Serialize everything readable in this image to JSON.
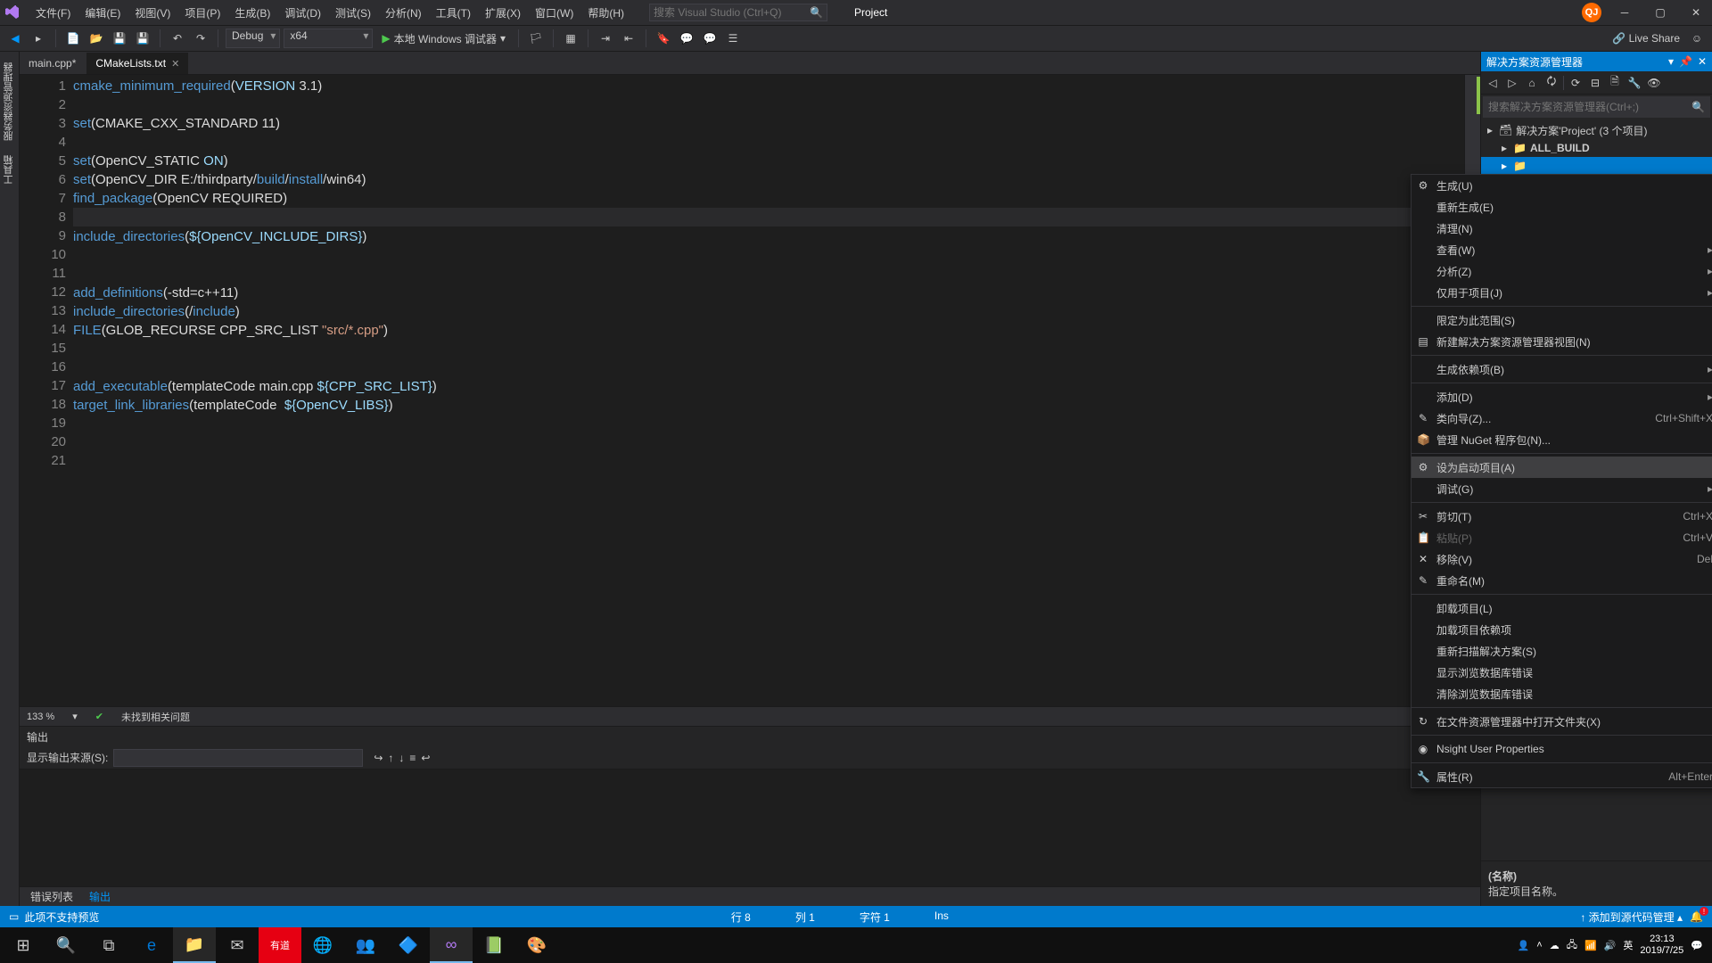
{
  "titlebar": {
    "menus": [
      "文件(F)",
      "编辑(E)",
      "视图(V)",
      "项目(P)",
      "生成(B)",
      "调试(D)",
      "测试(S)",
      "分析(N)",
      "工具(T)",
      "扩展(X)",
      "窗口(W)",
      "帮助(H)"
    ],
    "search_placeholder": "搜索 Visual Studio (Ctrl+Q)",
    "project_title": "Project",
    "user_badge": "QJ"
  },
  "toolbar": {
    "config": "Debug",
    "platform": "x64",
    "debug_label": "本地 Windows 调试器",
    "live_share": "Live Share"
  },
  "left_toolwell": [
    "服务器资源管理器",
    "工具箱"
  ],
  "tabs": {
    "items": [
      {
        "label": "main.cpp*",
        "active": false
      },
      {
        "label": "CMakeLists.txt",
        "active": true
      }
    ]
  },
  "code": {
    "lines": [
      {
        "n": 1,
        "html": "<span class='cmd'>cmake_minimum_required</span>(<span class='var'>VERSION</span> 3.1)"
      },
      {
        "n": 2,
        "html": ""
      },
      {
        "n": 3,
        "html": "<span class='cmd'>set</span>(CMAKE_CXX_STANDARD 11)"
      },
      {
        "n": 4,
        "html": ""
      },
      {
        "n": 5,
        "html": "<span class='cmd'>set</span>(OpenCV_STATIC <span class='var'>ON</span>)"
      },
      {
        "n": 6,
        "html": "<span class='cmd'>set</span>(OpenCV_DIR E:/thirdparty/<span class='path'>build</span>/<span class='path'>install</span>/win64)"
      },
      {
        "n": 7,
        "html": "<span class='cmd'>find_package</span>(OpenCV REQUIRED)"
      },
      {
        "n": 8,
        "html": ""
      },
      {
        "n": 9,
        "html": "<span class='cmd'>include_directories</span>(<span class='var'>${OpenCV_INCLUDE_DIRS}</span>)"
      },
      {
        "n": 10,
        "html": ""
      },
      {
        "n": 11,
        "html": ""
      },
      {
        "n": 12,
        "html": "<span class='cmd'>add_definitions</span>(-std=c++11)"
      },
      {
        "n": 13,
        "html": "<span class='cmd'>include_directories</span>(/<span class='path'>include</span>)"
      },
      {
        "n": 14,
        "html": "<span class='cmd'>FILE</span>(GLOB_RECURSE CPP_SRC_LIST <span class='str'>\"src/*.cpp\"</span>)"
      },
      {
        "n": 15,
        "html": ""
      },
      {
        "n": 16,
        "html": ""
      },
      {
        "n": 17,
        "html": "<span class='cmd'>add_executable</span>(templateCode main.cpp <span class='var'>${CPP_SRC_LIST}</span>)"
      },
      {
        "n": 18,
        "html": "<span class='cmd'>target_link_libraries</span>(templateCode  <span class='var'>${OpenCV_LIBS}</span>)"
      },
      {
        "n": 19,
        "html": ""
      },
      {
        "n": 20,
        "html": ""
      },
      {
        "n": 21,
        "html": ""
      }
    ],
    "cursor_line": 8
  },
  "status_strip": {
    "zoom": "133 %",
    "issues": "未找到相关问题"
  },
  "output": {
    "title": "输出",
    "source_label": "显示输出来源(S):"
  },
  "bottom_tabs": [
    "错误列表",
    "输出"
  ],
  "solution_panel": {
    "title": "解决方案资源管理器",
    "search_placeholder": "搜索解决方案资源管理器(Ctrl+;)",
    "solution_label": "解决方案'Project' (3 个项目)",
    "items": [
      {
        "name": "ALL_BUILD",
        "selected": false
      },
      {
        "name": "",
        "selected": true
      }
    ]
  },
  "context_menu": {
    "groups": [
      [
        {
          "label": "生成(U)",
          "icon": "⚙"
        },
        {
          "label": "重新生成(E)"
        },
        {
          "label": "清理(N)"
        },
        {
          "label": "查看(W)",
          "sub": true
        },
        {
          "label": "分析(Z)",
          "sub": true
        },
        {
          "label": "仅用于项目(J)",
          "sub": true
        }
      ],
      [
        {
          "label": "限定为此范围(S)"
        },
        {
          "label": "新建解决方案资源管理器视图(N)",
          "icon": "▤"
        }
      ],
      [
        {
          "label": "生成依赖项(B)",
          "sub": true
        }
      ],
      [
        {
          "label": "添加(D)",
          "sub": true
        },
        {
          "label": "类向导(Z)...",
          "icon": "✎",
          "shortcut": "Ctrl+Shift+X"
        },
        {
          "label": "管理 NuGet 程序包(N)...",
          "icon": "📦"
        }
      ],
      [
        {
          "label": "设为启动项目(A)",
          "icon": "⚙",
          "highlighted": true
        },
        {
          "label": "调试(G)",
          "sub": true
        }
      ],
      [
        {
          "label": "剪切(T)",
          "icon": "✂",
          "shortcut": "Ctrl+X"
        },
        {
          "label": "粘贴(P)",
          "icon": "📋",
          "shortcut": "Ctrl+V",
          "disabled": true
        },
        {
          "label": "移除(V)",
          "icon": "✕",
          "shortcut": "Del"
        },
        {
          "label": "重命名(M)",
          "icon": "✎"
        }
      ],
      [
        {
          "label": "卸载项目(L)"
        },
        {
          "label": "加载项目依赖项"
        },
        {
          "label": "重新扫描解决方案(S)"
        },
        {
          "label": "显示浏览数据库错误"
        },
        {
          "label": "清除浏览数据库错误"
        }
      ],
      [
        {
          "label": "在文件资源管理器中打开文件夹(X)",
          "icon": "↻"
        }
      ],
      [
        {
          "label": "Nsight User Properties",
          "icon": "◉"
        }
      ],
      [
        {
          "label": "属性(R)",
          "icon": "🔧",
          "shortcut": "Alt+Enter"
        }
      ]
    ]
  },
  "props_panel": {
    "name_label": "(名称)",
    "desc": "指定项目名称。"
  },
  "statusbar": {
    "ready_msg": "此项不支持预览",
    "line": "行 8",
    "col": "列 1",
    "char": "字符 1",
    "ins": "Ins",
    "source_control": "添加到源代码管理"
  },
  "taskbar": {
    "tray_ime": "英",
    "clock_time": "23:13",
    "clock_date": "2019/7/25"
  }
}
